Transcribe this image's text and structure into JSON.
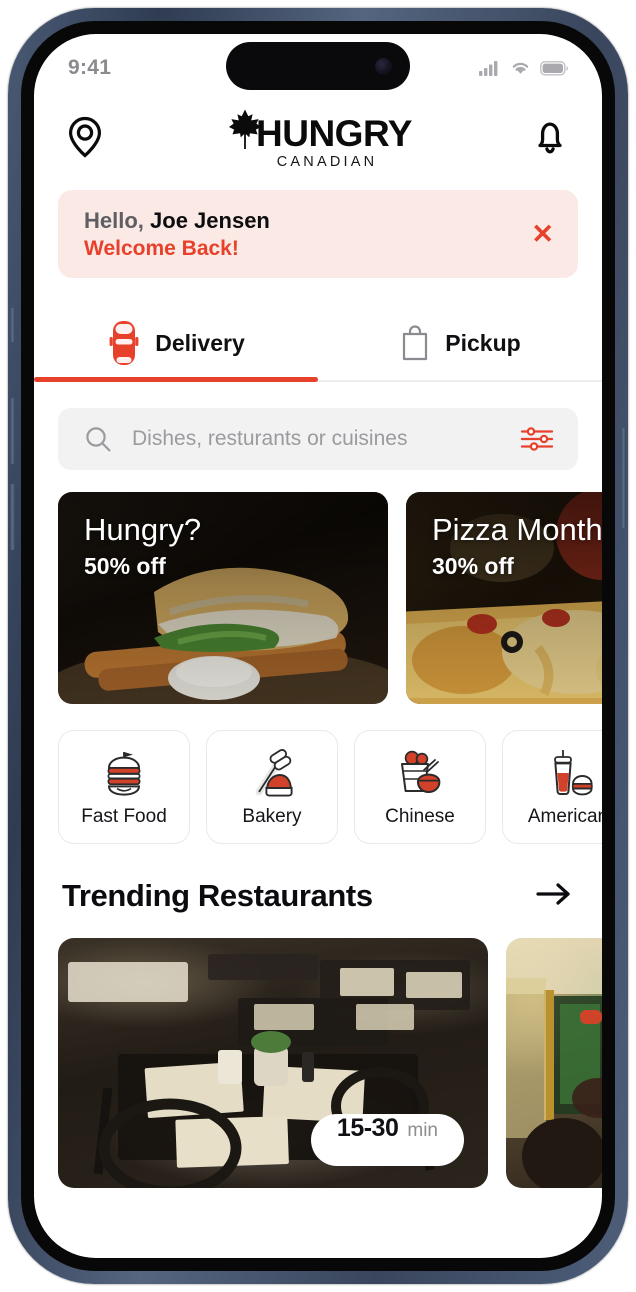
{
  "status_bar": {
    "time": "9:41",
    "signal_icon": "cellular-signal-icon",
    "wifi_icon": "wifi-icon",
    "battery_icon": "battery-icon"
  },
  "header": {
    "location_icon": "location-pin-icon",
    "brand_name": "HUNGRY",
    "brand_sub": "CANADIAN",
    "leaf_icon": "maple-leaf-icon",
    "notification_icon": "bell-icon"
  },
  "welcome_banner": {
    "hello": "Hello,",
    "user_name": "Joe Jensen",
    "message": "Welcome Back!",
    "close_label": "✕",
    "bg_color": "#fbe9e5",
    "accent_color": "#e8412b"
  },
  "tabs": [
    {
      "label": "Delivery",
      "icon": "car-icon",
      "active": true
    },
    {
      "label": "Pickup",
      "icon": "shopping-bag-icon",
      "active": false
    }
  ],
  "search": {
    "placeholder": "Dishes, resturants or cuisines",
    "value": "",
    "search_icon": "search-icon",
    "filter_icon": "filter-sliders-icon"
  },
  "promos": [
    {
      "title": "Hungry?",
      "subtitle": "50% off",
      "image": "sandwich-photo"
    },
    {
      "title": "Pizza Month",
      "subtitle": "30% off",
      "image": "pizza-photo"
    }
  ],
  "categories": [
    {
      "label": "Fast Food",
      "icon": "burger-icon"
    },
    {
      "label": "Bakery",
      "icon": "rolling-pin-icon"
    },
    {
      "label": "Chinese",
      "icon": "noodle-bowl-icon"
    },
    {
      "label": "American",
      "icon": "soda-burger-icon"
    }
  ],
  "trending": {
    "title": "Trending Restaurants",
    "arrow_icon": "arrow-right-icon",
    "restaurants": [
      {
        "image": "restaurant-interior-tables",
        "delivery_time": "15-30",
        "time_unit": "min"
      },
      {
        "image": "restaurant-interior-window"
      }
    ]
  },
  "theme": {
    "accent": "#e8412b",
    "text_primary": "#0c0c10",
    "text_muted": "#8e8e93",
    "surface": "#f2f2f3"
  }
}
